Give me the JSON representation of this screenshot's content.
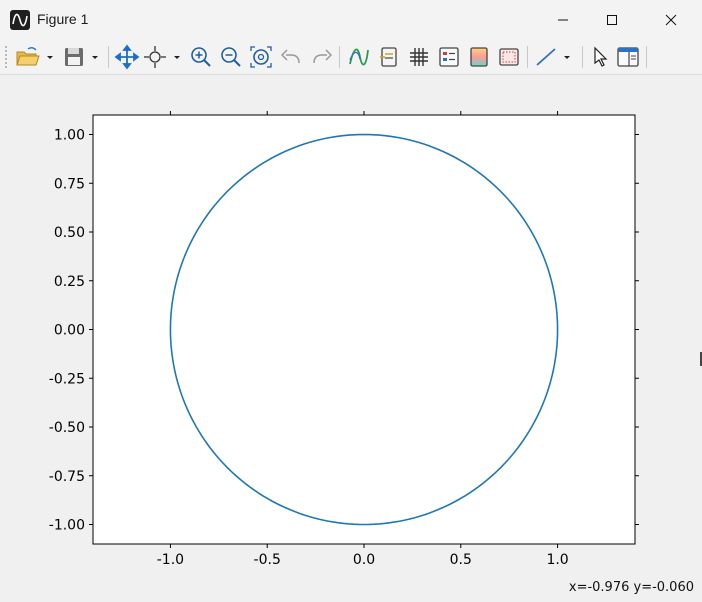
{
  "window": {
    "title": "Figure 1",
    "icon": "matplotlib-logo-icon"
  },
  "window_controls": [
    "minimize-icon",
    "maximize-icon",
    "close-icon"
  ],
  "toolbar": {
    "buttons": [
      {
        "name": "open",
        "icon": "folder-open-icon",
        "has_dropdown": true
      },
      {
        "name": "save",
        "icon": "floppy-disk-icon",
        "has_dropdown": true
      },
      {
        "name": "pan",
        "icon": "move-arrows-icon"
      },
      {
        "name": "zoom-to-rect",
        "icon": "crosshair-icon",
        "has_dropdown": true
      },
      {
        "name": "zoom-in",
        "icon": "zoom-in-icon"
      },
      {
        "name": "zoom-out",
        "icon": "zoom-out-icon"
      },
      {
        "name": "zoom-fit",
        "icon": "zoom-fit-icon"
      },
      {
        "name": "undo",
        "icon": "undo-icon"
      },
      {
        "name": "redo",
        "icon": "redo-icon"
      },
      {
        "name": "curve-style",
        "icon": "curve-icon"
      },
      {
        "name": "data-cursor",
        "icon": "cursor-label-icon"
      },
      {
        "name": "grid",
        "icon": "grid-icon"
      },
      {
        "name": "legend",
        "icon": "legend-icon"
      },
      {
        "name": "colormap",
        "icon": "colormap-icon"
      },
      {
        "name": "axes-settings",
        "icon": "axes-frame-icon"
      },
      {
        "name": "line-tool",
        "icon": "line-icon",
        "has_dropdown": true
      },
      {
        "name": "select",
        "icon": "pointer-icon"
      },
      {
        "name": "figure-options",
        "icon": "panel-layout-icon"
      }
    ]
  },
  "status": {
    "coords": "x=-0.976 y=-0.060"
  },
  "colors": {
    "series": "#1f77b4",
    "background": "#f0f0f0",
    "plot_background": "#ffffff"
  },
  "chart_data": {
    "type": "line",
    "title": "",
    "xlabel": "",
    "ylabel": "",
    "xlim": [
      -1.4,
      1.4
    ],
    "ylim": [
      -1.1,
      1.1
    ],
    "xticks": [
      -1.0,
      -0.5,
      0.0,
      0.5,
      1.0
    ],
    "xtick_labels": [
      "-1.0",
      "-0.5",
      "0.0",
      "0.5",
      "1.0"
    ],
    "yticks": [
      1.0,
      0.75,
      0.5,
      0.25,
      0.0,
      -0.25,
      -0.5,
      -0.75,
      -1.0
    ],
    "ytick_labels": [
      "1.00",
      "0.75",
      "0.50",
      "0.25",
      "0.00",
      "-0.25",
      "-0.50",
      "-0.75",
      "-1.00"
    ],
    "grid": false,
    "series": [
      {
        "shape": "unit circle x=cos(t), y=sin(t)",
        "x": [
          1.0,
          0.966,
          0.866,
          0.707,
          0.5,
          0.259,
          0.0,
          -0.259,
          -0.5,
          -0.707,
          -0.866,
          -0.966,
          -1.0,
          -0.966,
          -0.866,
          -0.707,
          -0.5,
          -0.259,
          0.0,
          0.259,
          0.5,
          0.707,
          0.866,
          0.966,
          1.0
        ],
        "y": [
          0.0,
          0.259,
          0.5,
          0.707,
          0.866,
          0.966,
          1.0,
          0.966,
          0.866,
          0.707,
          0.5,
          0.259,
          0.0,
          -0.259,
          -0.5,
          -0.707,
          -0.866,
          -0.966,
          -1.0,
          -0.966,
          -0.866,
          -0.707,
          -0.5,
          -0.259,
          0.0
        ]
      }
    ]
  }
}
